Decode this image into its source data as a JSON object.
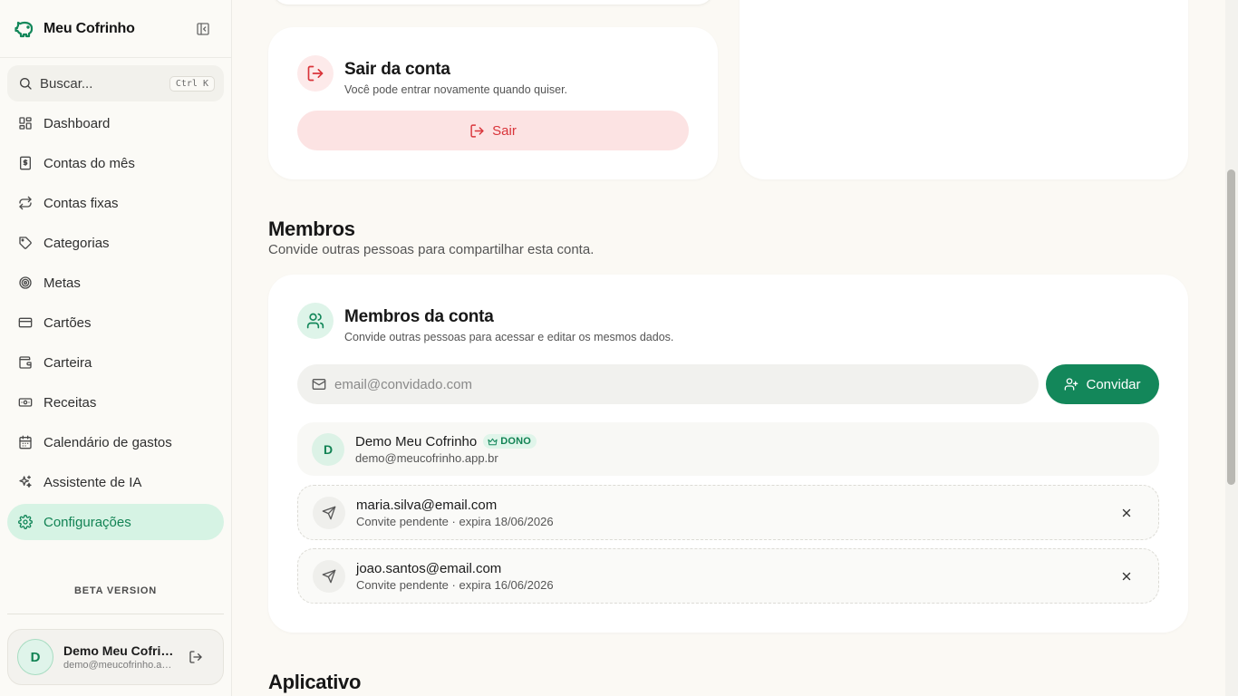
{
  "brand": {
    "name": "Meu Cofrinho"
  },
  "search": {
    "placeholder": "Buscar...",
    "shortcut": "Ctrl K"
  },
  "nav": {
    "items": [
      {
        "label": "Dashboard",
        "icon": "dashboard-icon"
      },
      {
        "label": "Contas do mês",
        "icon": "receipt-icon"
      },
      {
        "label": "Contas fixas",
        "icon": "repeat-icon"
      },
      {
        "label": "Categorias",
        "icon": "tag-icon"
      },
      {
        "label": "Metas",
        "icon": "target-icon"
      },
      {
        "label": "Cartões",
        "icon": "credit-card-icon"
      },
      {
        "label": "Carteira",
        "icon": "wallet-icon"
      },
      {
        "label": "Receitas",
        "icon": "banknote-icon"
      },
      {
        "label": "Calendário de gastos",
        "icon": "calendar-icon"
      },
      {
        "label": "Assistente de IA",
        "icon": "sparkles-icon"
      },
      {
        "label": "Configurações",
        "icon": "gear-icon",
        "active": true
      }
    ]
  },
  "beta_label": "BETA VERSION",
  "user": {
    "initial": "D",
    "name": "Demo Meu Cofrinho",
    "email": "demo@meucofrinho.app.br"
  },
  "logout_card": {
    "title": "Sair da conta",
    "subtitle": "Você pode entrar novamente quando quiser.",
    "button": "Sair"
  },
  "members_section": {
    "title": "Membros",
    "subtitle": "Convide outras pessoas para compartilhar esta conta."
  },
  "members_card": {
    "title": "Membros da conta",
    "subtitle": "Convide outras pessoas para acessar e editar os mesmos dados.",
    "input_placeholder": "email@convidado.com",
    "invite_button": "Convidar",
    "owner": {
      "initial": "D",
      "name": "Demo Meu Cofrinho",
      "badge": "DONO",
      "email": "demo@meucofrinho.app.br"
    },
    "pending": [
      {
        "email": "maria.silva@email.com",
        "status": "Convite pendente · expira 18/06/2026"
      },
      {
        "email": "joao.santos@email.com",
        "status": "Convite pendente · expira 16/06/2026"
      }
    ]
  },
  "app_section": {
    "title": "Aplicativo"
  },
  "colors": {
    "accent": "#13875a",
    "accent_soft": "#d6f3e4",
    "danger": "#d9343a",
    "danger_soft": "#fce3e3"
  }
}
